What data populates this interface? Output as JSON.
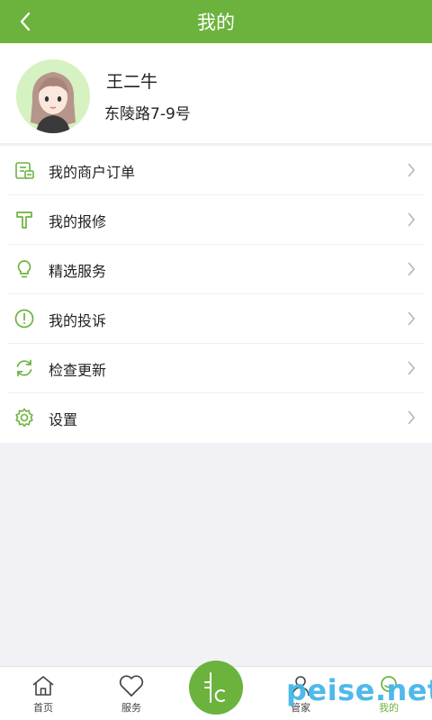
{
  "header": {
    "title": "我的"
  },
  "profile": {
    "name": "王二牛",
    "address": "东陵路7-9号"
  },
  "menu": [
    {
      "label": "我的商户订单",
      "icon": "merchant-order-icon"
    },
    {
      "label": "我的报修",
      "icon": "repair-hammer-icon"
    },
    {
      "label": "精选服务",
      "icon": "lightbulb-icon"
    },
    {
      "label": "我的投诉",
      "icon": "complaint-alert-icon"
    },
    {
      "label": "检查更新",
      "icon": "refresh-icon"
    },
    {
      "label": "设置",
      "icon": "gear-icon"
    }
  ],
  "tabbar": {
    "home": "首页",
    "services": "服务",
    "steward": "管家",
    "mine": "我的"
  },
  "colors": {
    "accent": "#6cb33e",
    "watermark": "#45b6e9"
  },
  "watermark": "peise.net"
}
